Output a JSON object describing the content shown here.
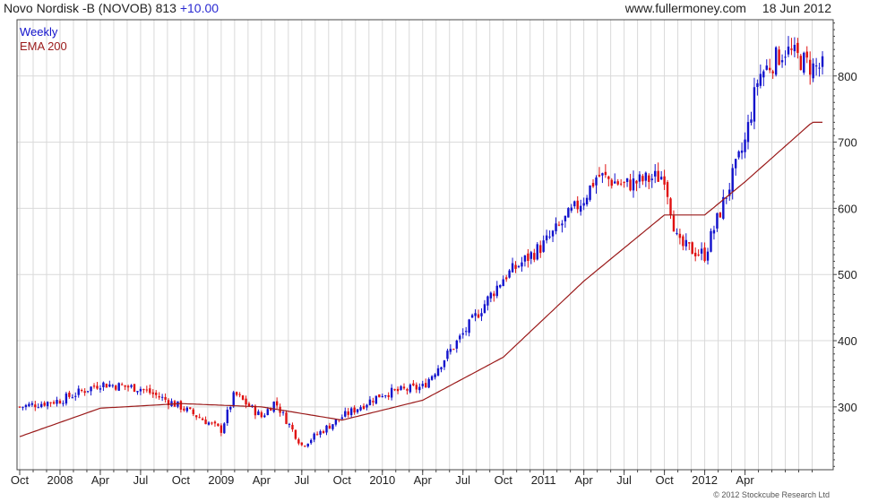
{
  "header": {
    "title": "Novo Nordisk -B (NOVOB) 813",
    "change": "+10.00",
    "site": "www.fullermoney.com",
    "date": "18 Jun 2012"
  },
  "copyright": "© 2012 Stockcube Research Ltd",
  "colors": {
    "up": "#1212cc",
    "down": "#e01010",
    "ema": "#9a1a1a",
    "grid": "#d9d9d9",
    "axis": "#444444"
  },
  "chart_data": {
    "type": "candlestick",
    "title": "Novo Nordisk -B (NOVOB) 813",
    "xlabel": "",
    "ylabel": "",
    "ylim": [
      205,
      885
    ],
    "y_ticks": [
      300,
      400,
      500,
      600,
      700,
      800
    ],
    "x_ticks": [
      "Oct",
      "2008",
      "Apr",
      "Jul",
      "Oct",
      "2009",
      "Apr",
      "Jul",
      "Oct",
      "2010",
      "Apr",
      "Jul",
      "Oct",
      "2011",
      "Apr",
      "Jul",
      "Oct",
      "2012",
      "Apr"
    ],
    "grid": true,
    "legend": {
      "placement": "top-left",
      "entries": [
        "Weekly",
        "EMA 200"
      ]
    },
    "series": [
      {
        "name": "Weekly",
        "kind": "weekly candles (close path)",
        "keypoints": [
          [
            "Jul 2007",
            300
          ],
          [
            "Oct 2007",
            310
          ],
          [
            "Jan 2008",
            335
          ],
          [
            "Apr 2008",
            328
          ],
          [
            "Jul 2008",
            300
          ],
          [
            "Oct 2008",
            265
          ],
          [
            "Nov 2008",
            320
          ],
          [
            "Jan 2009",
            285
          ],
          [
            "Feb 2009",
            308
          ],
          [
            "Apr 2009",
            242
          ],
          [
            "Jul 2009",
            285
          ],
          [
            "Oct 2009",
            320
          ],
          [
            "Jan 2010",
            330
          ],
          [
            "Apr 2010",
            410
          ],
          [
            "Jul 2010",
            495
          ],
          [
            "Oct 2010",
            545
          ],
          [
            "Jan 2011",
            615
          ],
          [
            "Feb 2011",
            650
          ],
          [
            "Apr 2011",
            635
          ],
          [
            "Jul 2011",
            650
          ],
          [
            "Aug 2011",
            545
          ],
          [
            "Oct 2011",
            530
          ],
          [
            "Jan 2012",
            700
          ],
          [
            "Feb 2012",
            800
          ],
          [
            "Apr 2012",
            840
          ],
          [
            "Jun 2012",
            813
          ]
        ]
      },
      {
        "name": "EMA 200",
        "kind": "line",
        "keypoints": [
          [
            "Jul 2007",
            255
          ],
          [
            "Jan 2008",
            298
          ],
          [
            "Jul 2008",
            305
          ],
          [
            "Jan 2009",
            300
          ],
          [
            "Jul 2009",
            280
          ],
          [
            "Jan 2010",
            310
          ],
          [
            "Jul 2010",
            375
          ],
          [
            "Jan 2011",
            490
          ],
          [
            "Jul 2011",
            590
          ],
          [
            "Oct 2011",
            590
          ],
          [
            "Jan 2012",
            640
          ],
          [
            "Jun 2012",
            730
          ]
        ]
      }
    ]
  }
}
